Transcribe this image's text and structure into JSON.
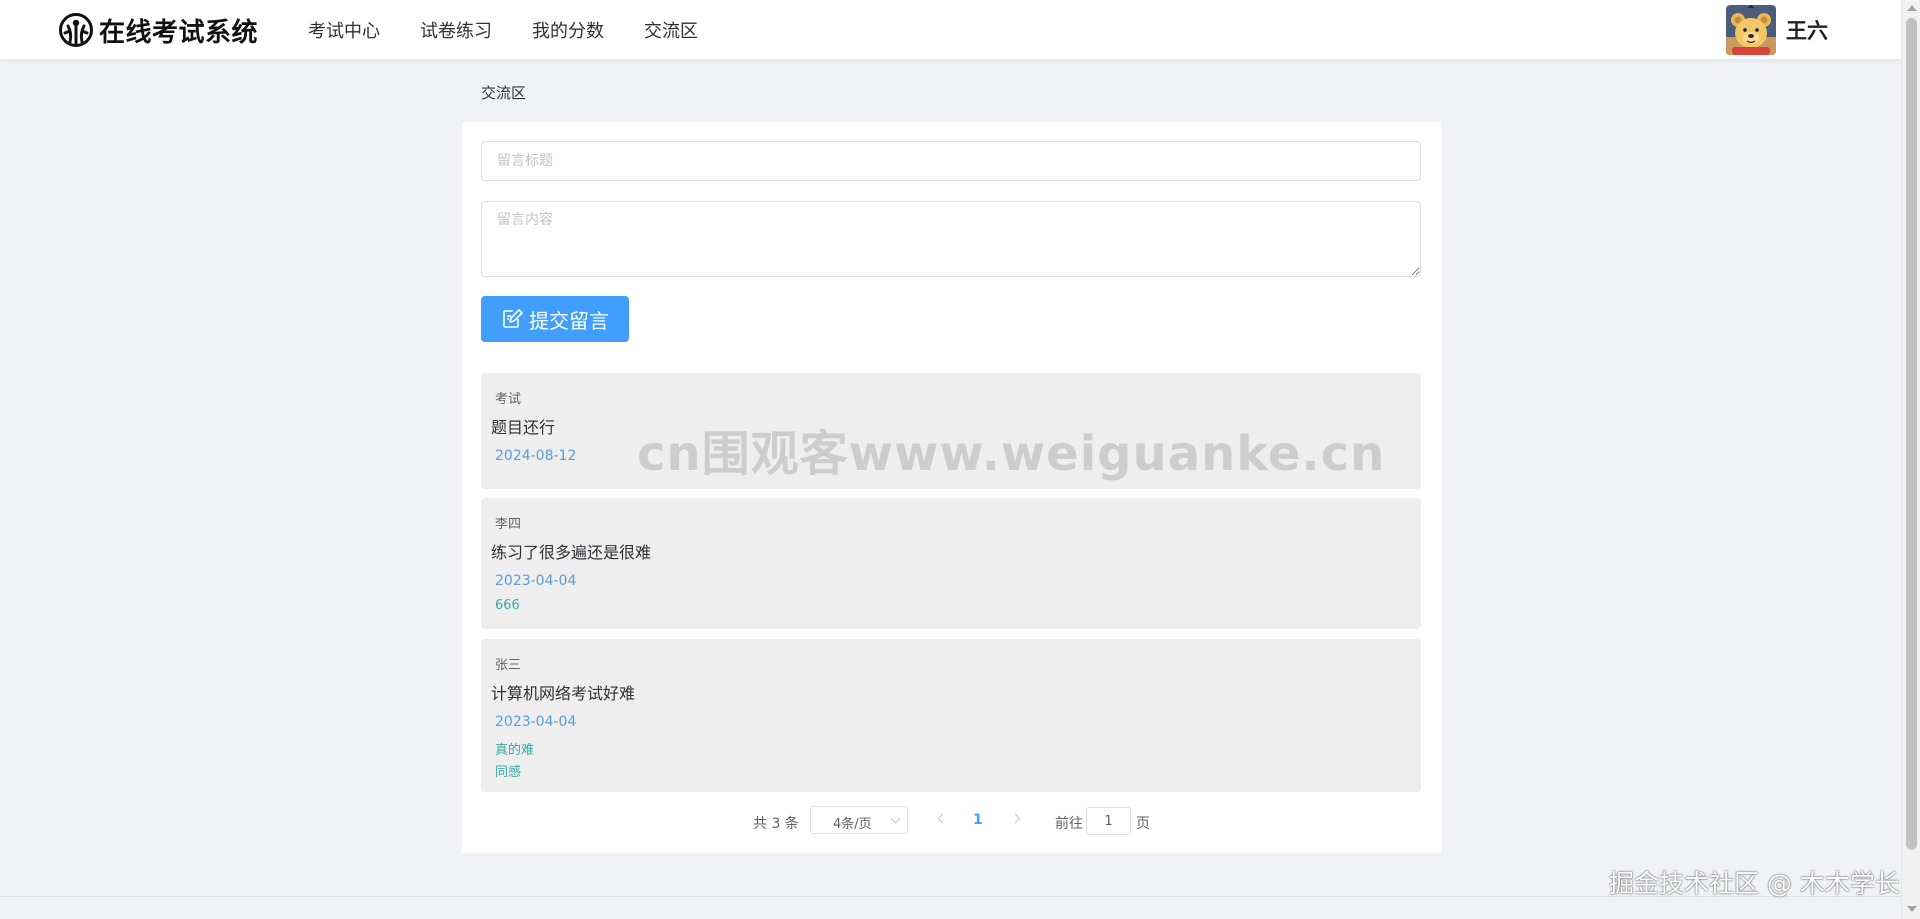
{
  "header": {
    "app_title": "在线考试系统",
    "nav": [
      {
        "label": "考试中心"
      },
      {
        "label": "试卷练习"
      },
      {
        "label": "我的分数"
      },
      {
        "label": "交流区"
      }
    ],
    "username": "王六"
  },
  "breadcrumb": "交流区",
  "form": {
    "title_placeholder": "留言标题",
    "title_value": "",
    "content_placeholder": "留言内容",
    "content_value": "",
    "submit_label": "提交留言"
  },
  "comments": [
    {
      "author": "考试",
      "content": "题目还行",
      "date": "2024-08-12",
      "replies": []
    },
    {
      "author": "李四",
      "content": "练习了很多遍还是很难",
      "date": "2023-04-04",
      "replies": [
        "666"
      ]
    },
    {
      "author": "张三",
      "content": "计算机网络考试好难",
      "date": "2023-04-04",
      "replies": [
        "真的难",
        "同感"
      ]
    }
  ],
  "pagination": {
    "total_text": "共 3 条",
    "page_size": "4条/页",
    "current_page": "1",
    "goto_label": "前往",
    "goto_value": "1",
    "page_suffix": "页"
  },
  "watermarks": {
    "center": "cn围观客www.weiguanke.cn",
    "corner": "掘金技术社区 @ 木木学长"
  },
  "colors": {
    "primary": "#409eff",
    "date": "#5a9bd8",
    "reply": "#3aa99f",
    "background": "#f0f2f5"
  }
}
